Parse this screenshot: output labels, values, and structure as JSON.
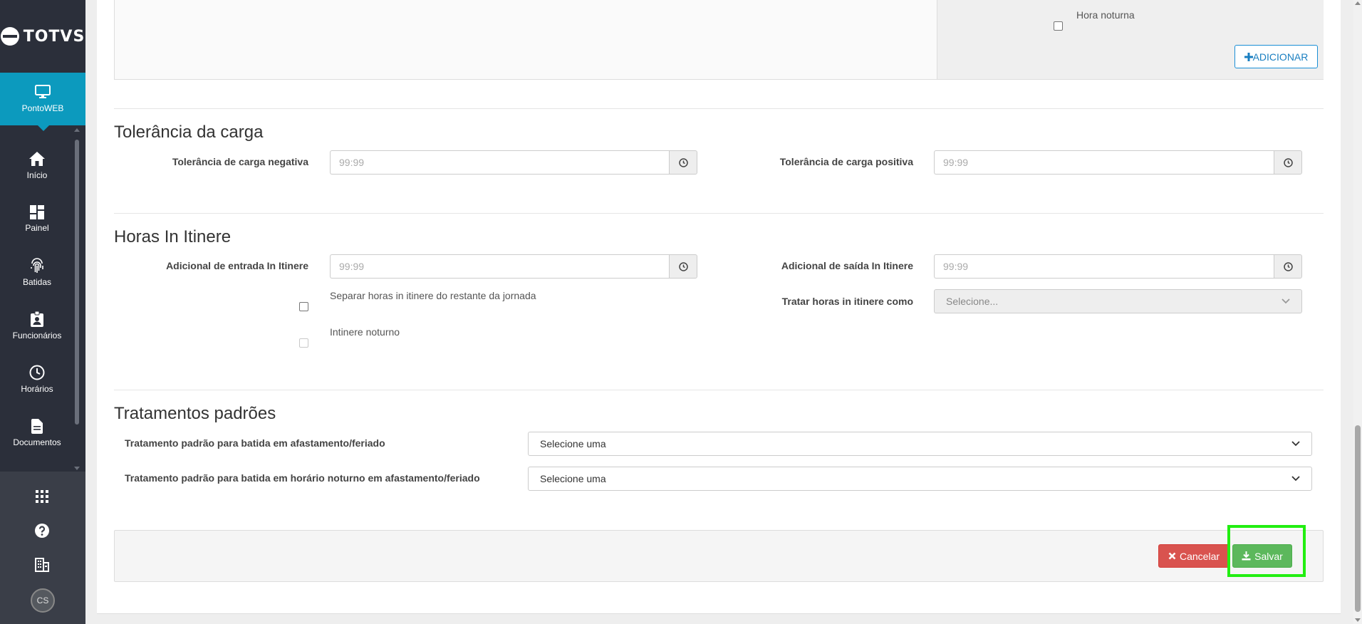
{
  "brand": {
    "name": "TOTVS",
    "module": "PontoWEB"
  },
  "sidebar": {
    "items": [
      {
        "label": "Início",
        "icon": "home-icon"
      },
      {
        "label": "Painel",
        "icon": "dashboard-icon"
      },
      {
        "label": "Batidas",
        "icon": "fingerprint-icon"
      },
      {
        "label": "Funcionários",
        "icon": "employee-badge-icon"
      },
      {
        "label": "Horários",
        "icon": "clock-icon"
      },
      {
        "label": "Documentos",
        "icon": "document-icon"
      }
    ],
    "avatar_initials": "CS"
  },
  "top_panel": {
    "hora_noturna_label": "Hora noturna",
    "add_button": "ADICIONAR"
  },
  "tolerancia": {
    "title": "Tolerância da carga",
    "negativa_label": "Tolerância de carga negativa",
    "positiva_label": "Tolerância de carga positiva",
    "placeholder": "99:99"
  },
  "itinere": {
    "title": "Horas In Itinere",
    "entrada_label": "Adicional de entrada In Itinere",
    "saida_label": "Adicional de saída In Itinere",
    "placeholder": "99:99",
    "separar_label": "Separar horas in itinere do restante da jornada",
    "tratar_label": "Tratar horas in itinere como",
    "tratar_value": "Selecione...",
    "noturno_label": "Intinere noturno"
  },
  "tratamentos": {
    "title": "Tratamentos padrões",
    "afastamento_label": "Tratamento padrão para batida em afastamento/feriado",
    "afastamento_value": "Selecione uma",
    "noturno_label": "Tratamento padrão para batida em horário noturno em afastamento/feriado",
    "noturno_value": "Selecione uma"
  },
  "footer": {
    "cancel_label": "Cancelar",
    "save_label": "Salvar"
  },
  "colors": {
    "sidebar": "#2b2f3a",
    "active": "#0c9abe",
    "cancel": "#d9534f",
    "save": "#5cb85c",
    "highlight": "#22ee11"
  }
}
